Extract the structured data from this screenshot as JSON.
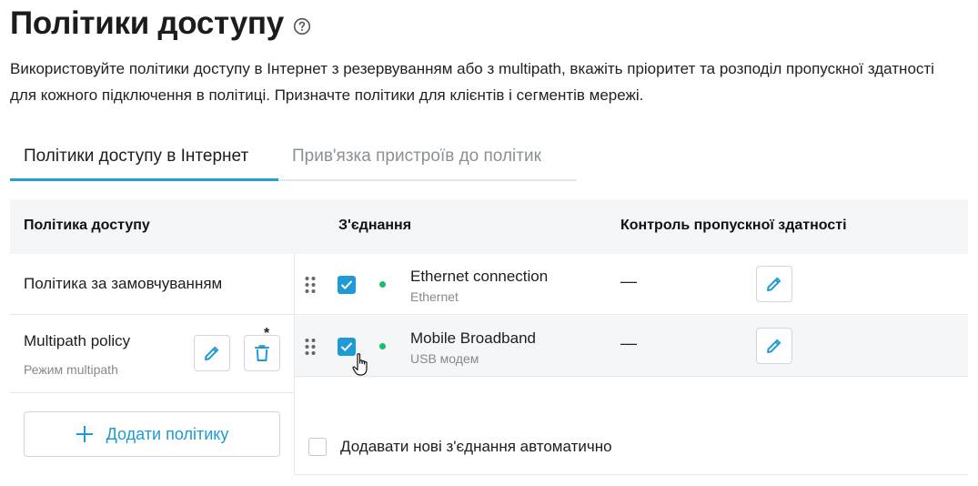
{
  "page": {
    "title": "Політики доступу",
    "description": "Використовуйте політики доступу в Інтернет з резервуванням або з multipath, вкажіть пріоритет та розподіл пропускної здатності для кожного підключення в політиці. Призначте політики для клієнтів і сегментів мережі."
  },
  "tabs": [
    {
      "label": "Політики доступу в Інтернет",
      "active": true
    },
    {
      "label": "Прив'язка пристроїв до політик",
      "active": false
    }
  ],
  "table": {
    "headers": {
      "policy": "Політика доступу",
      "connection": "З'єднання",
      "bandwidth": "Контроль пропускної здатності"
    }
  },
  "policies": [
    {
      "name": "Політика за замовчуванням",
      "subtitle": ""
    },
    {
      "name": "Multipath policy",
      "subtitle": "Режим multipath",
      "marker": "*"
    }
  ],
  "connections": [
    {
      "name": "Ethernet connection",
      "type": "Ethernet",
      "checked": true,
      "status": "online",
      "bandwidth": "—"
    },
    {
      "name": "Mobile Broadband",
      "type": "USB модем",
      "checked": true,
      "status": "online",
      "bandwidth": "—"
    }
  ],
  "actions": {
    "add_policy": "Додати політику",
    "auto_add_label": "Додавати нові з'єднання автоматично"
  },
  "colors": {
    "accent": "#1e9bd7",
    "status_online": "#1bbd6a",
    "header_bg": "#f3f5f6"
  },
  "icons": [
    "help-icon",
    "drag-handle-icon",
    "check-icon",
    "pencil-icon",
    "trash-icon",
    "plus-icon",
    "hand-cursor-icon"
  ]
}
